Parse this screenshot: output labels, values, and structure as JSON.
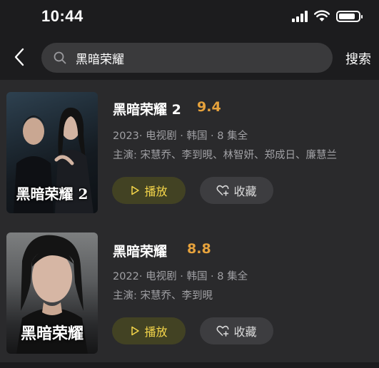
{
  "status_bar": {
    "time": "10:44",
    "icons": [
      "cellular-signal-icon",
      "wifi-icon",
      "battery-icon"
    ],
    "battery_level": 0.85
  },
  "header": {
    "back_icon": "chevron-left-icon",
    "search_icon": "search-icon",
    "search_value": "黑暗荣耀",
    "search_button": "搜索"
  },
  "results": [
    {
      "title": "黑暗荣耀 2",
      "score": "9.4",
      "meta": "2023· 电视剧 · 韩国 · 8 集全",
      "cast": "主演: 宋慧乔、李到晛、林智妍、郑成日、廉慧兰",
      "poster_text": "黑暗荣耀 2",
      "play_label": "播放",
      "fav_label": "收藏"
    },
    {
      "title": "黑暗荣耀",
      "score": "8.8",
      "meta": "2022· 电视剧 · 韩国 · 8 集全",
      "cast": "主演: 宋慧乔、李到晛",
      "poster_text": "黑暗荣耀",
      "play_label": "播放",
      "fav_label": "收藏"
    }
  ],
  "colors": {
    "background": "#1c1c1e",
    "list_background": "#2a2a2c",
    "score": "#e6a23c",
    "play_text": "#f5d64a",
    "play_bg": "#424223"
  }
}
